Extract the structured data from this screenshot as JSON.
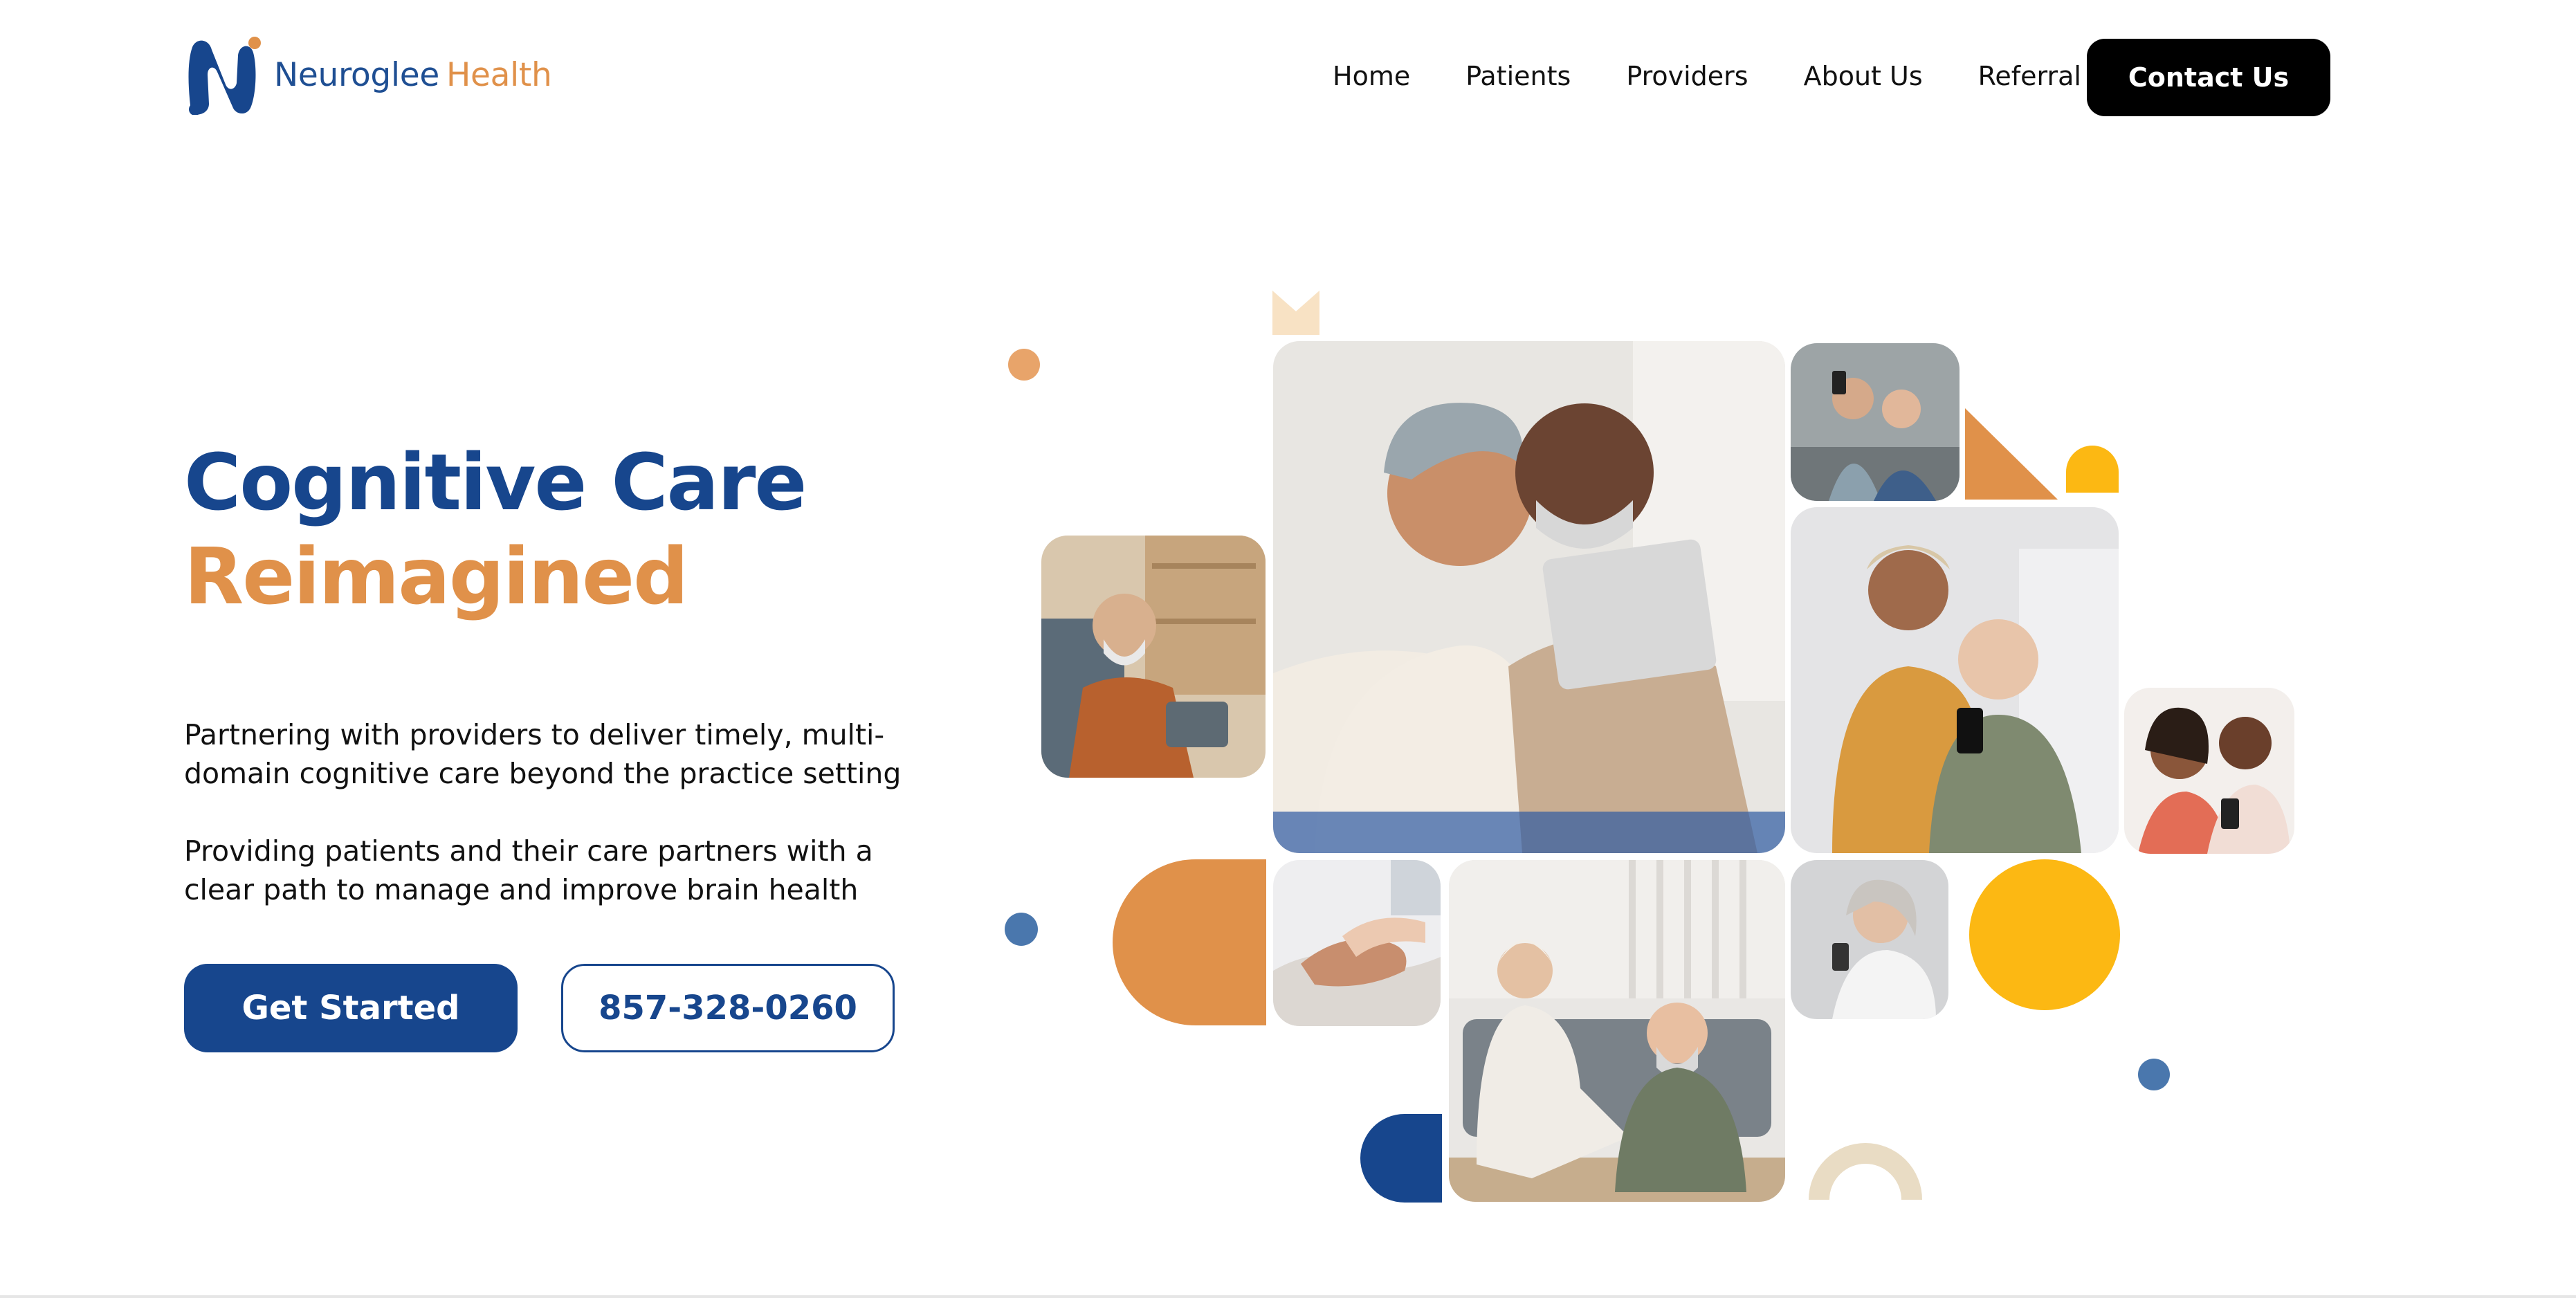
{
  "header": {
    "logo_word_1": "Neuroglee",
    "logo_word_2": "Health",
    "nav": [
      "Home",
      "Patients",
      "Providers",
      "About Us",
      "Referral"
    ],
    "contact_label": "Contact Us"
  },
  "hero": {
    "title_line_1": "Cognitive Care",
    "title_line_2": "Reimagined",
    "description_1": "Partnering with providers to deliver timely, multi-domain cognitive care beyond the practice setting",
    "description_2": "Providing patients and their care partners with a clear path to manage and improve brain health",
    "cta_primary": "Get Started",
    "cta_phone": "857-328-0260"
  },
  "colors": {
    "brand_blue": "#17468d",
    "brand_orange": "#e0914a",
    "accent_yellow": "#fcb813",
    "muted_blue": "#4a77ad",
    "sand": "#e9dcc4",
    "peach": "#f8e2c4"
  },
  "icons": [
    "neuroglee-logo-icon"
  ]
}
